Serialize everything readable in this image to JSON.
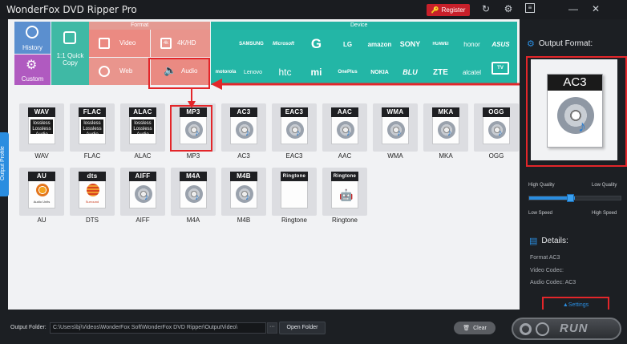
{
  "title_bar": {
    "app_title": "WonderFox DVD Ripper Pro",
    "register_label": "Register",
    "icons": [
      "refresh-icon",
      "gear-icon",
      "menu-icon",
      "minimize-icon",
      "close-icon"
    ]
  },
  "left_tiles": {
    "history": "History",
    "custom": "Custom",
    "quick_copy": "1:1 Quick Copy"
  },
  "format_section": {
    "header": "Format",
    "tiles": [
      "Video",
      "4K/HD",
      "Web",
      "Audio"
    ]
  },
  "device_section": {
    "header": "Device",
    "row1": [
      "apple",
      "SAMSUNG",
      "Microsoft",
      "G",
      "LG",
      "amazon",
      "SONY",
      "HUAWEI",
      "honor",
      "ASUS"
    ],
    "row2": [
      "motorola",
      "Lenovo",
      "htc",
      "mi",
      "OnePlus",
      "NOKIA",
      "BLU",
      "ZTE",
      "alcatel",
      "TV"
    ]
  },
  "side_tab": "Output Profile",
  "audio_formats": [
    {
      "tag": "WAV",
      "label": "WAV",
      "badge": "lossless\nLossless Audio"
    },
    {
      "tag": "FLAC",
      "label": "FLAC",
      "badge": "lossless\nLossless Audio"
    },
    {
      "tag": "ALAC",
      "label": "ALAC",
      "badge": "lossless\nLossless Audio"
    },
    {
      "tag": "MP3",
      "label": "MP3"
    },
    {
      "tag": "AC3",
      "label": "AC3"
    },
    {
      "tag": "EAC3",
      "label": "EAC3"
    },
    {
      "tag": "AAC",
      "label": "AAC"
    },
    {
      "tag": "WMA",
      "label": "WMA"
    },
    {
      "tag": "MKA",
      "label": "MKA"
    },
    {
      "tag": "OGG",
      "label": "OGG"
    },
    {
      "tag": "AU",
      "label": "AU",
      "badge": "Audio Units"
    },
    {
      "tag": "dts",
      "label": "DTS",
      "badge": "Surround"
    },
    {
      "tag": "AIFF",
      "label": "AIFF"
    },
    {
      "tag": "M4A",
      "label": "M4A"
    },
    {
      "tag": "M4B",
      "label": "M4B"
    },
    {
      "tag": "Ringtone",
      "label": "Ringtone"
    },
    {
      "tag": "Ringtone",
      "label": "Ringtone"
    }
  ],
  "output_panel": {
    "title": "Output Format:",
    "selected": "AC3",
    "high_quality": "High Quality",
    "low_quality": "Low Quality",
    "low_speed": "Low Speed",
    "high_speed": "High Speed",
    "slider_level": 0.5,
    "details_title": "Details:",
    "format_line": "Format AC3",
    "video_codec_line": "Video Codec:",
    "audio_codec_line": "Audio Codec: AC3",
    "settings_label": "Settings"
  },
  "bottom_bar": {
    "output_folder_label": "Output Folder:",
    "output_folder_value": "C:\\Users\\bj\\Videos\\WonderFox Soft\\WonderFox DVD Ripper\\OutputVideo\\",
    "dots_label": "···",
    "open_folder_label": "Open Folder",
    "clear_label": "Clear",
    "run_label": "RUN"
  },
  "colors": {
    "accent_blue": "#2a8de0",
    "format_red": "#ea8e86",
    "device_teal": "#23b6a6",
    "highlight_red": "#e3262a"
  }
}
